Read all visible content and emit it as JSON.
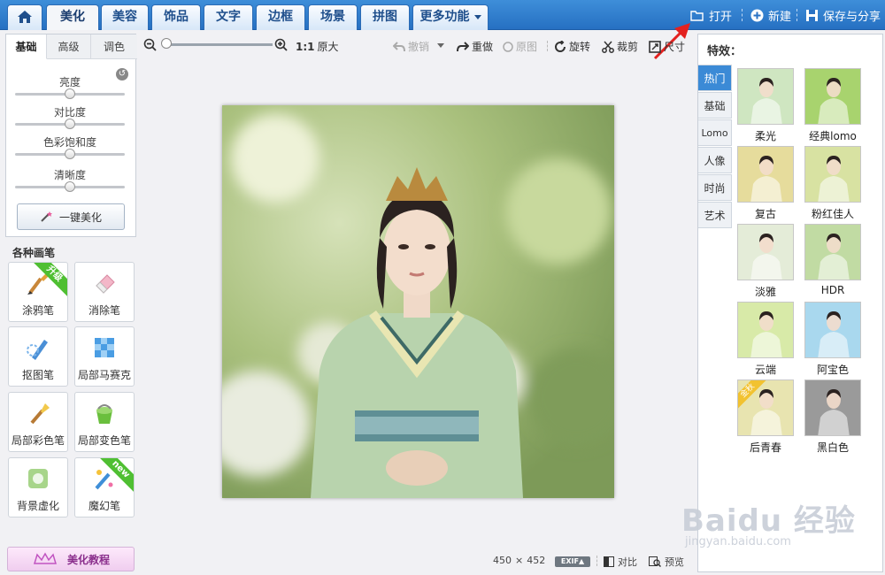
{
  "topbar": {
    "tabs": [
      {
        "label": "美化",
        "active": true
      },
      {
        "label": "美容"
      },
      {
        "label": "饰品"
      },
      {
        "label": "文字"
      },
      {
        "label": "边框"
      },
      {
        "label": "场景"
      },
      {
        "label": "拼图"
      },
      {
        "label": "更多功能"
      }
    ],
    "home_icon": "home-icon",
    "open_label": "打开",
    "new_label": "新建",
    "save_share_label": "保存与分享"
  },
  "left_panel": {
    "tabs": [
      "基础",
      "高级",
      "调色"
    ],
    "sliders": [
      {
        "label": "亮度",
        "value": 0.5
      },
      {
        "label": "对比度",
        "value": 0.5
      },
      {
        "label": "色彩饱和度",
        "value": 0.5
      },
      {
        "label": "清晰度",
        "value": 0.5
      }
    ],
    "one_key_label": "一键美化"
  },
  "brushes": {
    "title": "各种画笔",
    "items": [
      {
        "label": "涂鸦笔",
        "icon": "paintbrush-icon",
        "badge": "升级"
      },
      {
        "label": "消除笔",
        "icon": "eraser-icon"
      },
      {
        "label": "抠图笔",
        "icon": "cutout-pen-icon"
      },
      {
        "label": "局部马赛克",
        "icon": "mosaic-icon"
      },
      {
        "label": "局部彩色笔",
        "icon": "color-brush-icon"
      },
      {
        "label": "局部变色笔",
        "icon": "paint-bucket-icon"
      },
      {
        "label": "背景虚化",
        "icon": "blur-icon"
      },
      {
        "label": "魔幻笔",
        "icon": "magic-pen-icon",
        "badge": "new"
      }
    ]
  },
  "tutorial_label": "美化教程",
  "toolbar": {
    "ratio_label": "1:1",
    "original_size_label": "原大",
    "undo_label": "撤销",
    "redo_label": "重做",
    "original_label": "原图",
    "rotate_label": "旋转",
    "crop_label": "裁剪",
    "size_label": "尺寸"
  },
  "status": {
    "width": "450",
    "times": "×",
    "height": "452",
    "exif_label": "EXIF▲",
    "compare_label": "对比",
    "preview_label": "预览"
  },
  "effects": {
    "title": "特效：",
    "categories": [
      "热门",
      "基础",
      "Lomo",
      "人像",
      "时尚",
      "艺术"
    ],
    "items": [
      {
        "label": "柔光",
        "tint": "#cfe6c1"
      },
      {
        "label": "经典lomo",
        "tint": "#a8d36e"
      },
      {
        "label": "复古",
        "tint": "#e6dc9c"
      },
      {
        "label": "粉红佳人",
        "tint": "#d8e2a2"
      },
      {
        "label": "淡雅",
        "tint": "#e4ecd8"
      },
      {
        "label": "HDR",
        "tint": "#c1dba3"
      },
      {
        "label": "云端",
        "tint": "#d8eaa8"
      },
      {
        "label": "阿宝色",
        "tint": "#a9d8ee"
      },
      {
        "label": "后青春",
        "tint": "#e8e4b0",
        "badge": "金秋"
      },
      {
        "label": "黑白色",
        "tint": "#9a9a9a"
      }
    ]
  },
  "watermark": {
    "brand": "Baidu 经验",
    "url": "jingyan.baidu.com"
  }
}
